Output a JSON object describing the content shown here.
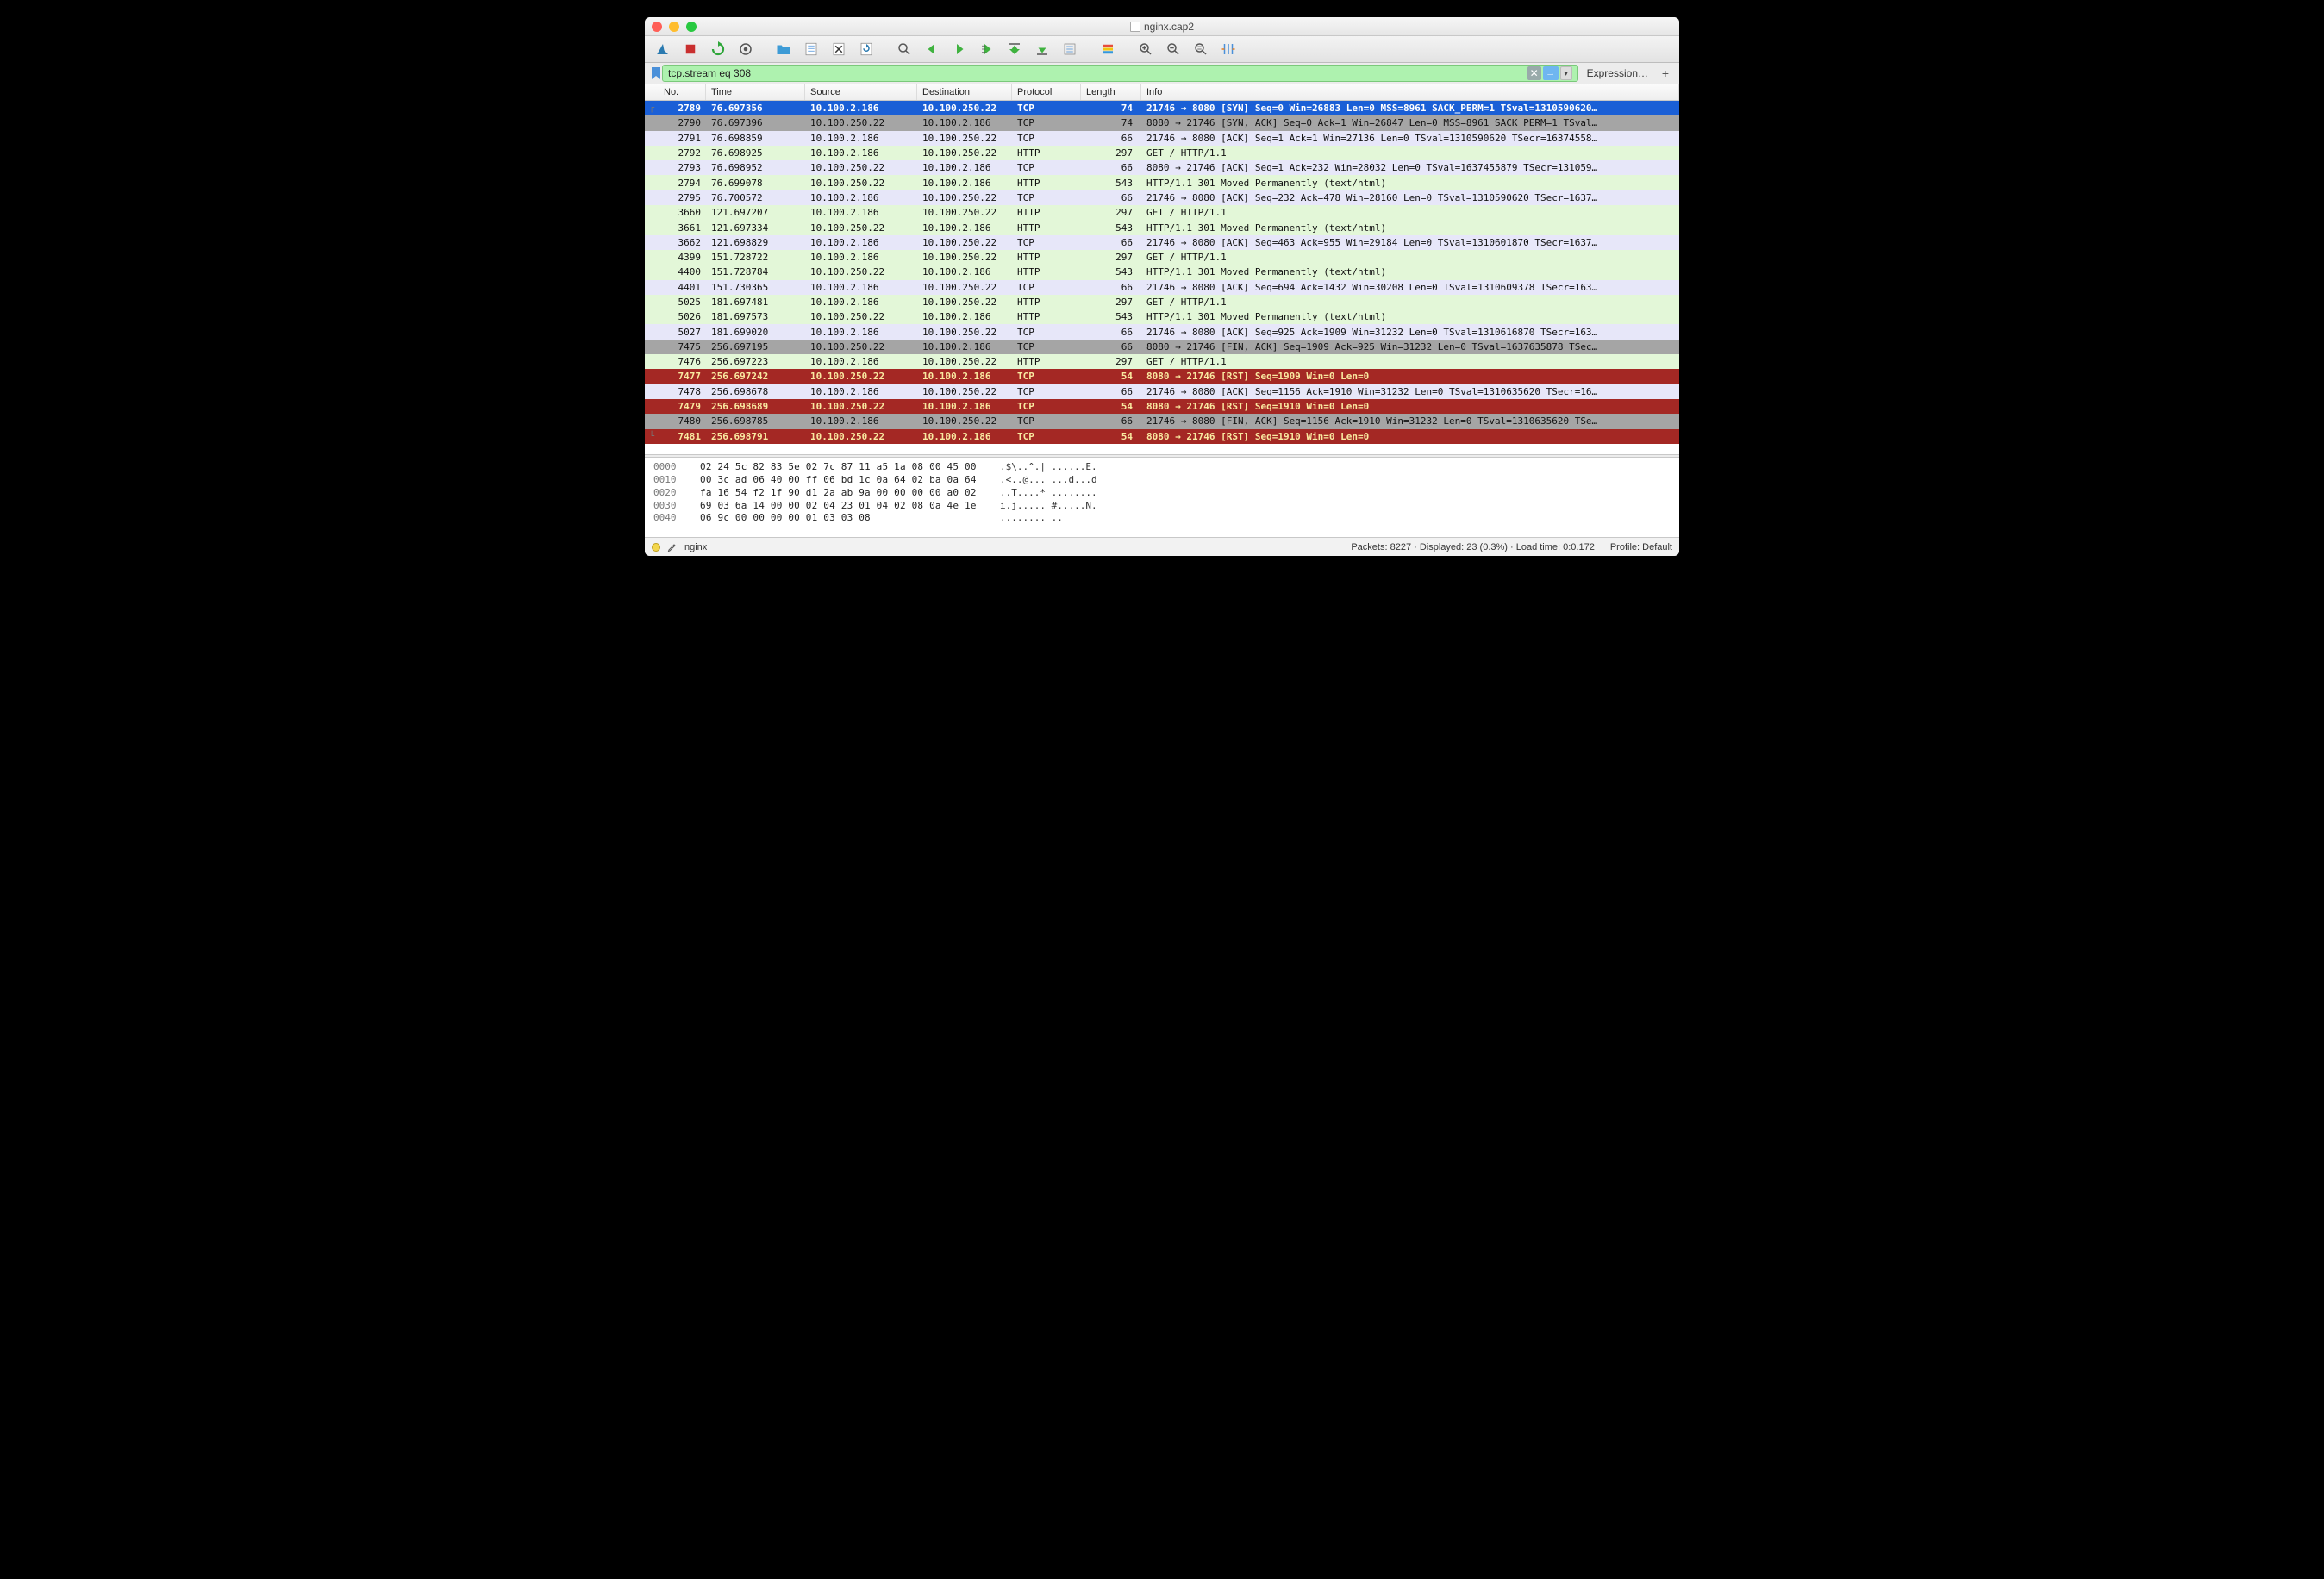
{
  "window": {
    "title": "nginx.cap2"
  },
  "filter": {
    "value": "tcp.stream eq 308",
    "expression_label": "Expression…"
  },
  "columns": {
    "no": "No.",
    "time": "Time",
    "source": "Source",
    "destination": "Destination",
    "protocol": "Protocol",
    "length": "Length",
    "info": "Info"
  },
  "packets": [
    {
      "no": "2789",
      "time": "76.697356",
      "src": "10.100.2.186",
      "dst": "10.100.250.22",
      "proto": "TCP",
      "len": "74",
      "info": "21746 → 8080 [SYN] Seq=0 Win=26883 Len=0 MSS=8961 SACK_PERM=1 TSval=1310590620…",
      "cls": "r-sel",
      "marker": "┌"
    },
    {
      "no": "2790",
      "time": "76.697396",
      "src": "10.100.250.22",
      "dst": "10.100.2.186",
      "proto": "TCP",
      "len": "74",
      "info": "8080 → 21746 [SYN, ACK] Seq=0 Ack=1 Win=26847 Len=0 MSS=8961 SACK_PERM=1 TSval…",
      "cls": "r-gray",
      "marker": ""
    },
    {
      "no": "2791",
      "time": "76.698859",
      "src": "10.100.2.186",
      "dst": "10.100.250.22",
      "proto": "TCP",
      "len": "66",
      "info": "21746 → 8080 [ACK] Seq=1 Ack=1 Win=27136 Len=0 TSval=1310590620 TSecr=16374558…",
      "cls": "r-lav",
      "marker": ""
    },
    {
      "no": "2792",
      "time": "76.698925",
      "src": "10.100.2.186",
      "dst": "10.100.250.22",
      "proto": "HTTP",
      "len": "297",
      "info": "GET / HTTP/1.1",
      "cls": "r-http",
      "marker": ""
    },
    {
      "no": "2793",
      "time": "76.698952",
      "src": "10.100.250.22",
      "dst": "10.100.2.186",
      "proto": "TCP",
      "len": "66",
      "info": "8080 → 21746 [ACK] Seq=1 Ack=232 Win=28032 Len=0 TSval=1637455879 TSecr=131059…",
      "cls": "r-lav",
      "marker": ""
    },
    {
      "no": "2794",
      "time": "76.699078",
      "src": "10.100.250.22",
      "dst": "10.100.2.186",
      "proto": "HTTP",
      "len": "543",
      "info": "HTTP/1.1 301 Moved Permanently  (text/html)",
      "cls": "r-http",
      "marker": ""
    },
    {
      "no": "2795",
      "time": "76.700572",
      "src": "10.100.2.186",
      "dst": "10.100.250.22",
      "proto": "TCP",
      "len": "66",
      "info": "21746 → 8080 [ACK] Seq=232 Ack=478 Win=28160 Len=0 TSval=1310590620 TSecr=1637…",
      "cls": "r-lav",
      "marker": ""
    },
    {
      "no": "3660",
      "time": "121.697207",
      "src": "10.100.2.186",
      "dst": "10.100.250.22",
      "proto": "HTTP",
      "len": "297",
      "info": "GET / HTTP/1.1",
      "cls": "r-http",
      "marker": ""
    },
    {
      "no": "3661",
      "time": "121.697334",
      "src": "10.100.250.22",
      "dst": "10.100.2.186",
      "proto": "HTTP",
      "len": "543",
      "info": "HTTP/1.1 301 Moved Permanently  (text/html)",
      "cls": "r-http",
      "marker": ""
    },
    {
      "no": "3662",
      "time": "121.698829",
      "src": "10.100.2.186",
      "dst": "10.100.250.22",
      "proto": "TCP",
      "len": "66",
      "info": "21746 → 8080 [ACK] Seq=463 Ack=955 Win=29184 Len=0 TSval=1310601870 TSecr=1637…",
      "cls": "r-lav",
      "marker": ""
    },
    {
      "no": "4399",
      "time": "151.728722",
      "src": "10.100.2.186",
      "dst": "10.100.250.22",
      "proto": "HTTP",
      "len": "297",
      "info": "GET / HTTP/1.1",
      "cls": "r-http",
      "marker": ""
    },
    {
      "no": "4400",
      "time": "151.728784",
      "src": "10.100.250.22",
      "dst": "10.100.2.186",
      "proto": "HTTP",
      "len": "543",
      "info": "HTTP/1.1 301 Moved Permanently  (text/html)",
      "cls": "r-http",
      "marker": ""
    },
    {
      "no": "4401",
      "time": "151.730365",
      "src": "10.100.2.186",
      "dst": "10.100.250.22",
      "proto": "TCP",
      "len": "66",
      "info": "21746 → 8080 [ACK] Seq=694 Ack=1432 Win=30208 Len=0 TSval=1310609378 TSecr=163…",
      "cls": "r-lav",
      "marker": ""
    },
    {
      "no": "5025",
      "time": "181.697481",
      "src": "10.100.2.186",
      "dst": "10.100.250.22",
      "proto": "HTTP",
      "len": "297",
      "info": "GET / HTTP/1.1",
      "cls": "r-http",
      "marker": ""
    },
    {
      "no": "5026",
      "time": "181.697573",
      "src": "10.100.250.22",
      "dst": "10.100.2.186",
      "proto": "HTTP",
      "len": "543",
      "info": "HTTP/1.1 301 Moved Permanently  (text/html)",
      "cls": "r-http",
      "marker": ""
    },
    {
      "no": "5027",
      "time": "181.699020",
      "src": "10.100.2.186",
      "dst": "10.100.250.22",
      "proto": "TCP",
      "len": "66",
      "info": "21746 → 8080 [ACK] Seq=925 Ack=1909 Win=31232 Len=0 TSval=1310616870 TSecr=163…",
      "cls": "r-lav",
      "marker": ""
    },
    {
      "no": "7475",
      "time": "256.697195",
      "src": "10.100.250.22",
      "dst": "10.100.2.186",
      "proto": "TCP",
      "len": "66",
      "info": "8080 → 21746 [FIN, ACK] Seq=1909 Ack=925 Win=31232 Len=0 TSval=1637635878 TSec…",
      "cls": "r-gray",
      "marker": ""
    },
    {
      "no": "7476",
      "time": "256.697223",
      "src": "10.100.2.186",
      "dst": "10.100.250.22",
      "proto": "HTTP",
      "len": "297",
      "info": "GET / HTTP/1.1",
      "cls": "r-http",
      "marker": ""
    },
    {
      "no": "7477",
      "time": "256.697242",
      "src": "10.100.250.22",
      "dst": "10.100.2.186",
      "proto": "TCP",
      "len": "54",
      "info": "8080 → 21746 [RST] Seq=1909 Win=0 Len=0",
      "cls": "r-red",
      "marker": ""
    },
    {
      "no": "7478",
      "time": "256.698678",
      "src": "10.100.2.186",
      "dst": "10.100.250.22",
      "proto": "TCP",
      "len": "66",
      "info": "21746 → 8080 [ACK] Seq=1156 Ack=1910 Win=31232 Len=0 TSval=1310635620 TSecr=16…",
      "cls": "r-lav",
      "marker": ""
    },
    {
      "no": "7479",
      "time": "256.698689",
      "src": "10.100.250.22",
      "dst": "10.100.2.186",
      "proto": "TCP",
      "len": "54",
      "info": "8080 → 21746 [RST] Seq=1910 Win=0 Len=0",
      "cls": "r-red",
      "marker": ""
    },
    {
      "no": "7480",
      "time": "256.698785",
      "src": "10.100.2.186",
      "dst": "10.100.250.22",
      "proto": "TCP",
      "len": "66",
      "info": "21746 → 8080 [FIN, ACK] Seq=1156 Ack=1910 Win=31232 Len=0 TSval=1310635620 TSe…",
      "cls": "r-gray",
      "marker": ""
    },
    {
      "no": "7481",
      "time": "256.698791",
      "src": "10.100.250.22",
      "dst": "10.100.2.186",
      "proto": "TCP",
      "len": "54",
      "info": "8080 → 21746 [RST] Seq=1910 Win=0 Len=0",
      "cls": "r-red",
      "marker": "└"
    }
  ],
  "hex": [
    {
      "off": "0000",
      "bytes": "02 24 5c 82 83 5e 02 7c  87 11 a5 1a 08 00 45 00",
      "ascii": ".$\\..^.| ......E."
    },
    {
      "off": "0010",
      "bytes": "00 3c ad 06 40 00 ff 06  bd 1c 0a 64 02 ba 0a 64",
      "ascii": ".<..@... ...d...d"
    },
    {
      "off": "0020",
      "bytes": "fa 16 54 f2 1f 90 d1 2a  ab 9a 00 00 00 00 a0 02",
      "ascii": "..T....* ........"
    },
    {
      "off": "0030",
      "bytes": "69 03 6a 14 00 00 02 04  23 01 04 02 08 0a 4e 1e",
      "ascii": "i.j..... #.....N."
    },
    {
      "off": "0040",
      "bytes": "06 9c 00 00 00 00 01 03  03 08",
      "ascii": "........ .."
    }
  ],
  "status": {
    "file_label": "nginx",
    "packets": "Packets: 8227 · Displayed: 23 (0.3%) · Load time: 0:0.172",
    "profile": "Profile: Default"
  }
}
